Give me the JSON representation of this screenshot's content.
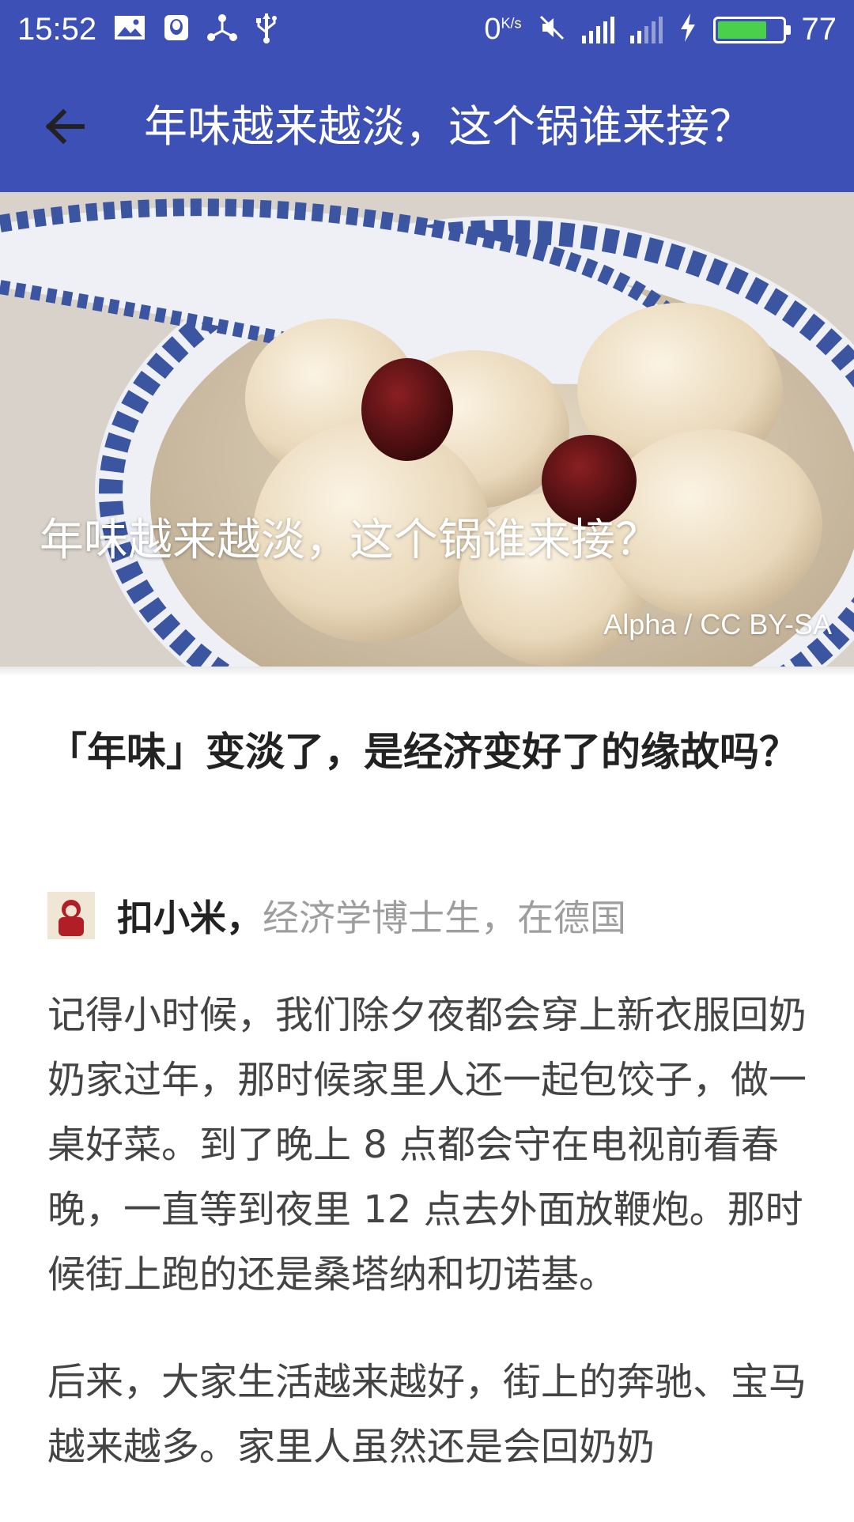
{
  "status_bar": {
    "time": "15:52",
    "net_speed": "0",
    "net_speed_unit": "K/s",
    "battery_level": "77",
    "battery_fill_fraction": 0.77,
    "battery_color": "#4bd04b"
  },
  "app_bar": {
    "title": "年味越来越淡，这个锅谁来接？",
    "background": "#3d50b5"
  },
  "hero": {
    "title": "年味越来越淡，这个锅谁来接？",
    "credit": "Alpha / CC BY-SA"
  },
  "article": {
    "question": "「年味」变淡了，是经济变好了的缘故吗？",
    "author_name": "扣小米，",
    "author_bio": "经济学博士生，在德国",
    "paragraphs": [
      "记得小时候，我们除夕夜都会穿上新衣服回奶奶家过年，那时候家里人还一起包饺子，做一桌好菜。到了晚上 8 点都会守在电视前看春晚，一直等到夜里 12 点去外面放鞭炮。那时候街上跑的还是桑塔纳和切诺基。",
      "后来，大家生活越来越好，街上的奔驰、宝马越来越多。家里人虽然还是会回奶奶"
    ]
  }
}
